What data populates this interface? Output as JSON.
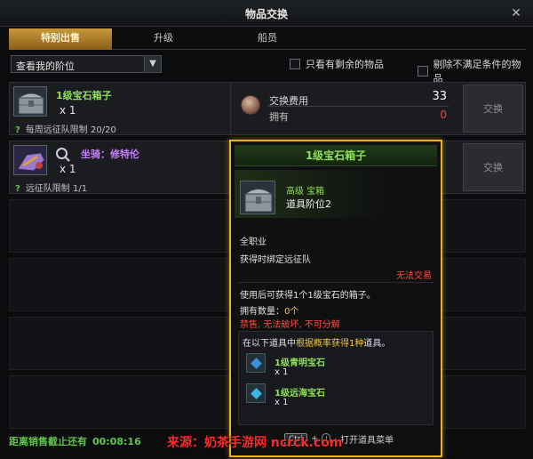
{
  "window": {
    "title": "物品交换"
  },
  "tabs": [
    {
      "label": "特别出售",
      "active": true
    },
    {
      "label": "升级",
      "active": false
    },
    {
      "label": "船员",
      "active": false
    }
  ],
  "filter": {
    "select_value": "查看我的阶位",
    "checkbox1": "只看有剩余的物品",
    "checkbox2": "剔除不满足条件的物品"
  },
  "items": [
    {
      "name": "1级宝石箱子",
      "name_color": "#8ee05a",
      "qty": "x 1",
      "limit": "每周远征队限制 20/20",
      "limit_mark": "?",
      "exchange_label": "交换",
      "cost_label": "交换费用",
      "cost_value": "33",
      "owned_label": "拥有",
      "owned_value": "0"
    },
    {
      "name": "坐骑：修特伦",
      "name_color": "#c77dff",
      "qty": "x 1",
      "limit": "远征队限制 1/1",
      "limit_mark": "?",
      "exchange_label": "交换"
    }
  ],
  "footer": {
    "label": "距离销售截止还有",
    "timer": "00:08:16"
  },
  "tooltip": {
    "title": "1级宝石箱子",
    "grade": "高级 宝箱",
    "tier": "道具阶位2",
    "class": "全职业",
    "bind": "获得时绑定远征队",
    "trade": "无法交易",
    "desc": "使用后可获得1个1级宝石的箱子。",
    "owned_label": "拥有数量：",
    "owned_value": "0个",
    "restrict": "禁售, 无法破坏, 不可分解",
    "list_head_a": "在以下道具中",
    "list_head_b": "根据概率获得1种",
    "list_head_c": "道具。",
    "gems": [
      {
        "name": "1级青明宝石",
        "qty": "x 1",
        "color": "#3d8fe0"
      },
      {
        "name": "1级远海宝石",
        "qty": "x 1",
        "color": "#3fb4e6"
      }
    ],
    "key": "Ctrl",
    "key_plus": "+",
    "key_action": ": 打开道具菜单"
  },
  "watermark": "来源：奶茶手游网 ncrck.com",
  "icons": {
    "close": "close-icon",
    "chest": "chest-icon",
    "mount": "mount-icon",
    "search": "search-icon",
    "coin": "coin-icon",
    "dropdown": "chevron-down-icon"
  }
}
